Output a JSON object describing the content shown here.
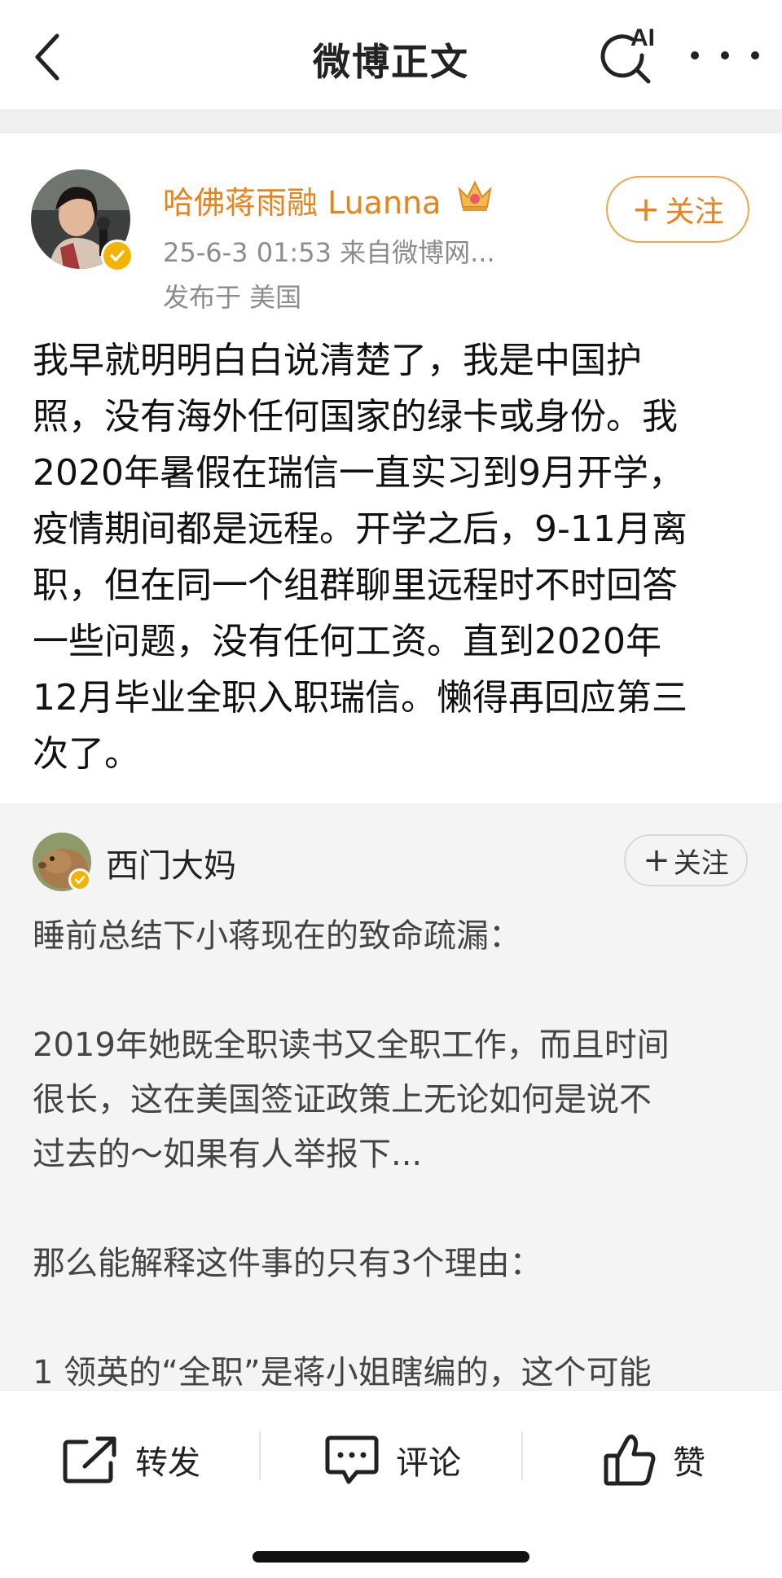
{
  "header": {
    "title": "微博正文",
    "ai_label": "AI",
    "back_icon": "chevron-left-icon",
    "search_icon": "ai-search-icon",
    "more_icon": "more-horizontal-icon"
  },
  "post": {
    "author": "哈佛蒋雨融 Luanna",
    "crown_icon": "crown-icon",
    "meta": "25-6-3 01:53  来自微博网...",
    "location": "发布于 美国",
    "follow_label": "关注",
    "body_lines": [
      "我早就明明白白说清楚了，我是中国护",
      "照，没有海外任何国家的绿卡或身份。我",
      "2020年暑假在瑞信一直实习到9月开学，",
      "疫情期间都是远程。开学之后，9-11月离",
      "职，但在同一个组群聊里远程时不时回答",
      "一些问题，没有任何工资。直到2020年",
      "12月毕业全职入职瑞信。懒得再回应第三",
      "次了。"
    ]
  },
  "quote": {
    "author": "西门大妈",
    "follow_label": "关注",
    "body_lines": [
      "睡前总结下小蒋现在的致命疏漏：",
      "",
      "2019年她既全职读书又全职工作，而且时间",
      "很长，这在美国签证政策上无论如何是说不",
      "过去的～如果有人举报下...",
      "",
      "那么能解释这件事的只有3个理由：",
      "",
      "1 领英的“全职”是蒋小姐瞎编的，这个可能"
    ]
  },
  "actions": {
    "repost": "转发",
    "comment": "评论",
    "like": "赞"
  },
  "colors": {
    "accent_orange": "#e8821a",
    "verify_gold": "#f4b300",
    "meta_gray": "#8c8c8c",
    "quote_bg": "#f4f4f4"
  }
}
